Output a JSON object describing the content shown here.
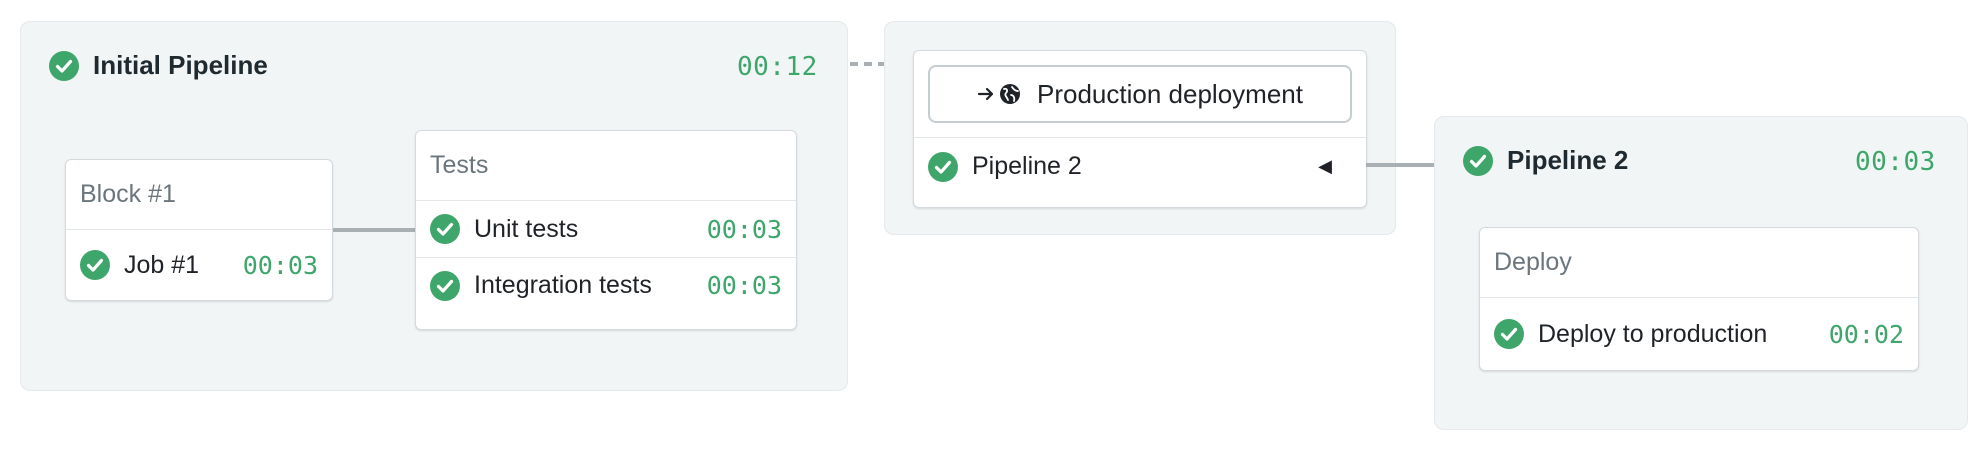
{
  "colors": {
    "success": "#3fa66b",
    "panel_bg": "#f2f5f6",
    "connector": "#a8b0b4"
  },
  "initial_pipeline": {
    "title": "Initial Pipeline",
    "duration": "00:12",
    "status_icon": "check-circle-icon",
    "blocks": [
      {
        "title": "Block #1",
        "jobs": [
          {
            "name": "Job #1",
            "duration": "00:03"
          }
        ]
      },
      {
        "title": "Tests",
        "jobs": [
          {
            "name": "Unit tests",
            "duration": "00:03"
          },
          {
            "name": "Integration tests",
            "duration": "00:03"
          }
        ]
      }
    ]
  },
  "promotion": {
    "button_label": "Production deployment",
    "button_icons": [
      "arrow-right-icon",
      "globe-icon"
    ],
    "target": {
      "name": "Pipeline 2",
      "indicator": "◀"
    }
  },
  "pipeline2": {
    "title": "Pipeline 2",
    "duration": "00:03",
    "status_icon": "check-circle-icon",
    "blocks": [
      {
        "title": "Deploy",
        "jobs": [
          {
            "name": "Deploy to production",
            "duration": "00:02"
          }
        ]
      }
    ]
  }
}
